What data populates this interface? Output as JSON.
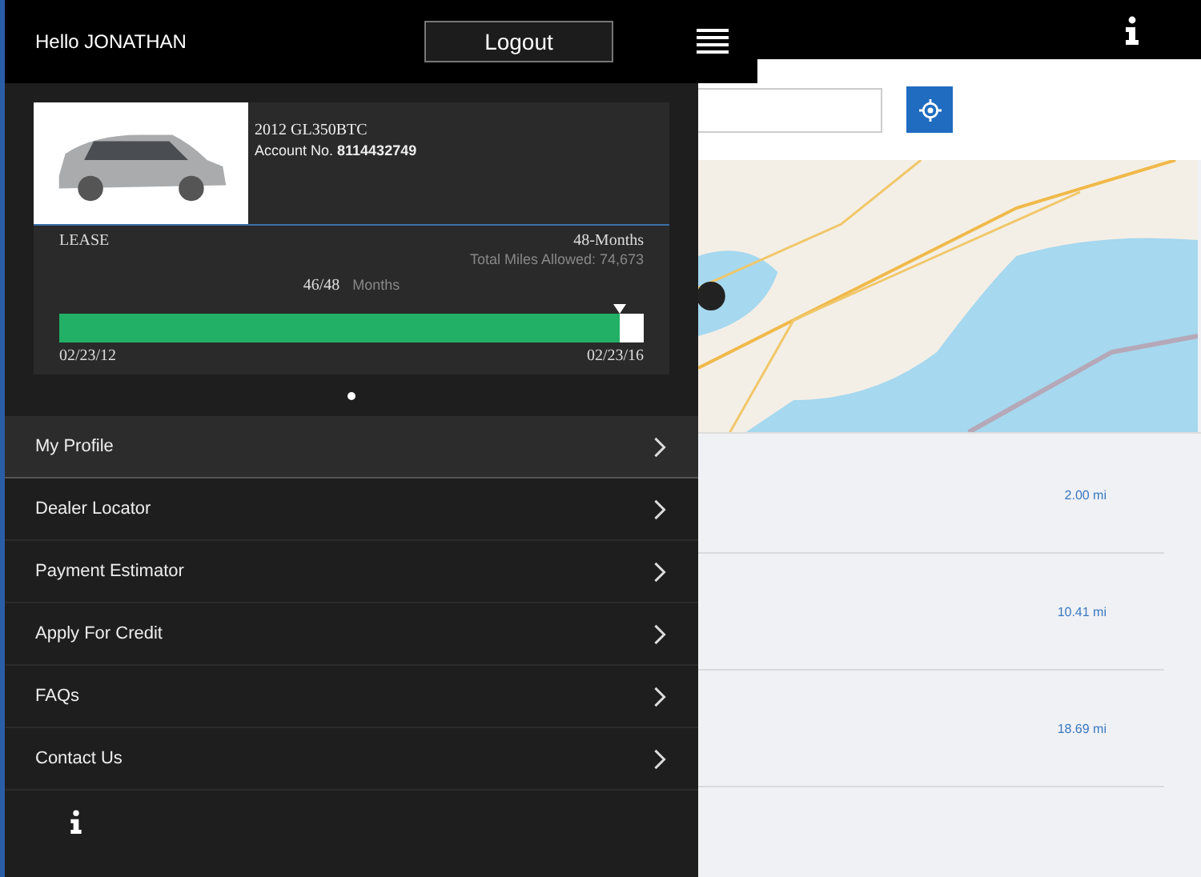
{
  "header": {
    "greeting": "Hello JONATHAN",
    "logout": "Logout"
  },
  "vehicle": {
    "model": "2012 GL350BTC",
    "account_label": "Account No.",
    "account_number": "8114432749"
  },
  "lease": {
    "type": "LEASE",
    "term": "48-Months",
    "total_miles": "Total Miles Allowed: 74,673",
    "months_elapsed": "46/48",
    "months_label": "Months",
    "level": 0.958,
    "start_date": "02/23/12",
    "end_date": "02/23/16"
  },
  "pager": [
    {
      "selected": true
    }
  ],
  "menu": [
    {
      "label": "My Profile",
      "selected": true
    },
    {
      "label": "Dealer Locator",
      "selected": false
    },
    {
      "label": "Payment Estimator",
      "selected": false
    },
    {
      "label": "Apply For Credit",
      "selected": false
    },
    {
      "label": "FAQs",
      "selected": false
    },
    {
      "label": "Contact Us",
      "selected": false
    }
  ],
  "results": [
    {
      "distance": "2.00 mi"
    },
    {
      "distance": "10.41 mi"
    },
    {
      "distance": "18.69 mi"
    }
  ]
}
